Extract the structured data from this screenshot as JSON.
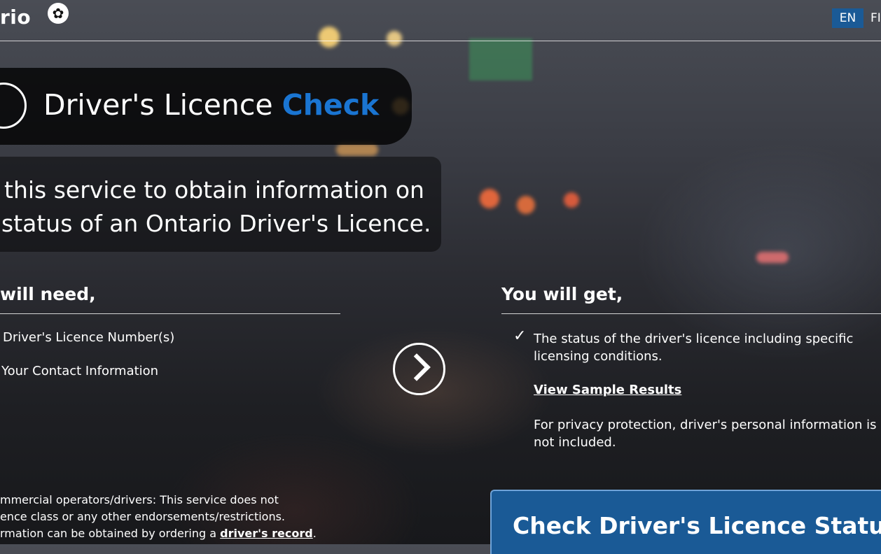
{
  "header": {
    "logo_text": "rio",
    "logo_icon": "trillium-icon",
    "lang_en": "EN",
    "lang_fr": "FI"
  },
  "hero": {
    "title_main": "Driver's Licence ",
    "title_accent": "Check",
    "intro_line1": "this service to obtain information on",
    "intro_line2": "status of an Ontario Driver's Licence."
  },
  "need": {
    "heading": "will need,",
    "items": [
      "Driver's Licence Number(s)",
      "Your Contact Information"
    ]
  },
  "get": {
    "heading": "You will get,",
    "check_glyph": "✓",
    "item": "The status of the driver's licence including specific licensing conditions.",
    "sample_link": "View Sample Results",
    "privacy": "For privacy protection, driver's personal information is not included."
  },
  "note": {
    "line1": "mmercial operators/drivers: This service does not",
    "line2": "ence class or any other endorsements/restrictions.",
    "line3_prefix": "rmation can be obtained by ordering a ",
    "line3_link": "driver's record",
    "line3_suffix": "."
  },
  "cta": {
    "label": "Check Driver's Licence Status"
  },
  "colors": {
    "accent": "#1a75d2",
    "brand_blue": "#1a5a96"
  }
}
